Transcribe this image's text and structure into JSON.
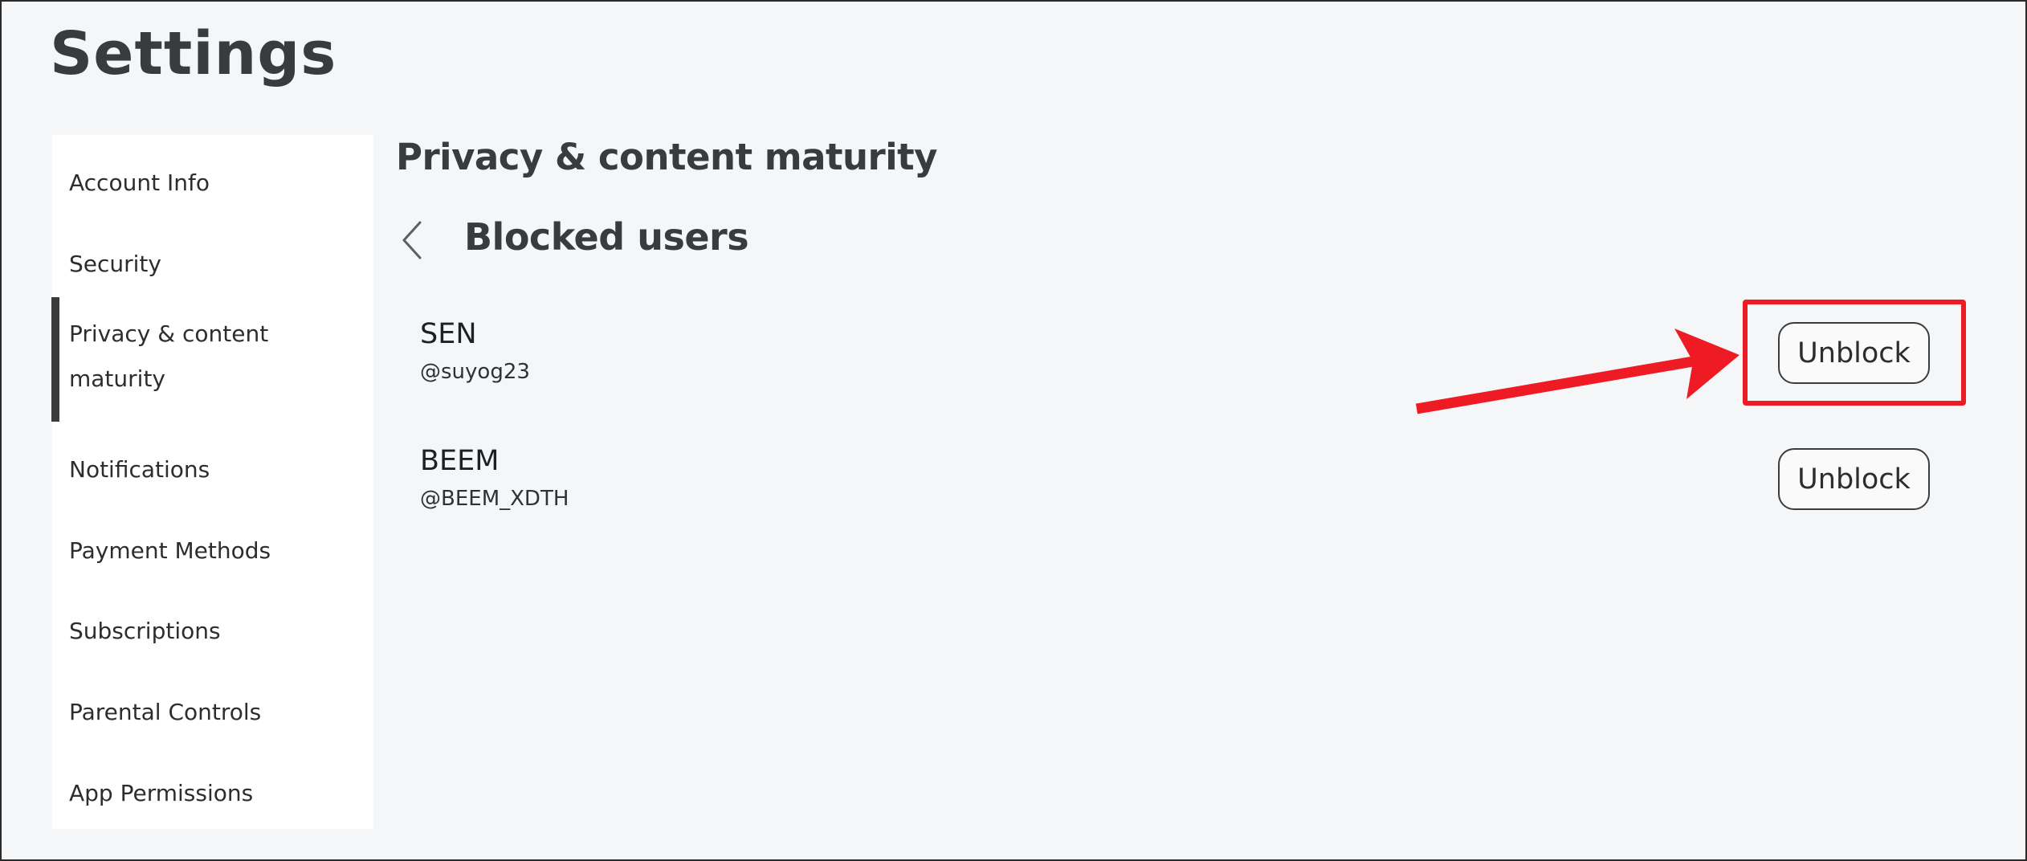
{
  "page": {
    "title": "Settings"
  },
  "sidebar": {
    "active_index": 2,
    "items": [
      {
        "label": "Account Info"
      },
      {
        "label": "Security"
      },
      {
        "label": "Privacy & content",
        "label_line2": "maturity"
      },
      {
        "label": "Notifications"
      },
      {
        "label": "Payment Methods"
      },
      {
        "label": "Subscriptions"
      },
      {
        "label": "Parental Controls"
      },
      {
        "label": "App Permissions"
      }
    ]
  },
  "main": {
    "section_title": "Privacy & content maturity",
    "back_icon": "chevron-left-icon",
    "subsection_title": "Blocked users",
    "blocked_users": [
      {
        "display_name": "SEN",
        "username": "@suyog23",
        "action_label": "Unblock"
      },
      {
        "display_name": "BEEM",
        "username": "@BEEM_XDTH",
        "action_label": "Unblock"
      }
    ]
  },
  "annotation": {
    "color": "#ee1b24",
    "highlighted_target": "Unblock"
  },
  "colors": {
    "text_primary": "#393b3d",
    "background": "#f5f6f8",
    "sidebar_background": "#ffffff",
    "active_indicator": "#393b3d",
    "annotation_red": "#ee1b24"
  }
}
